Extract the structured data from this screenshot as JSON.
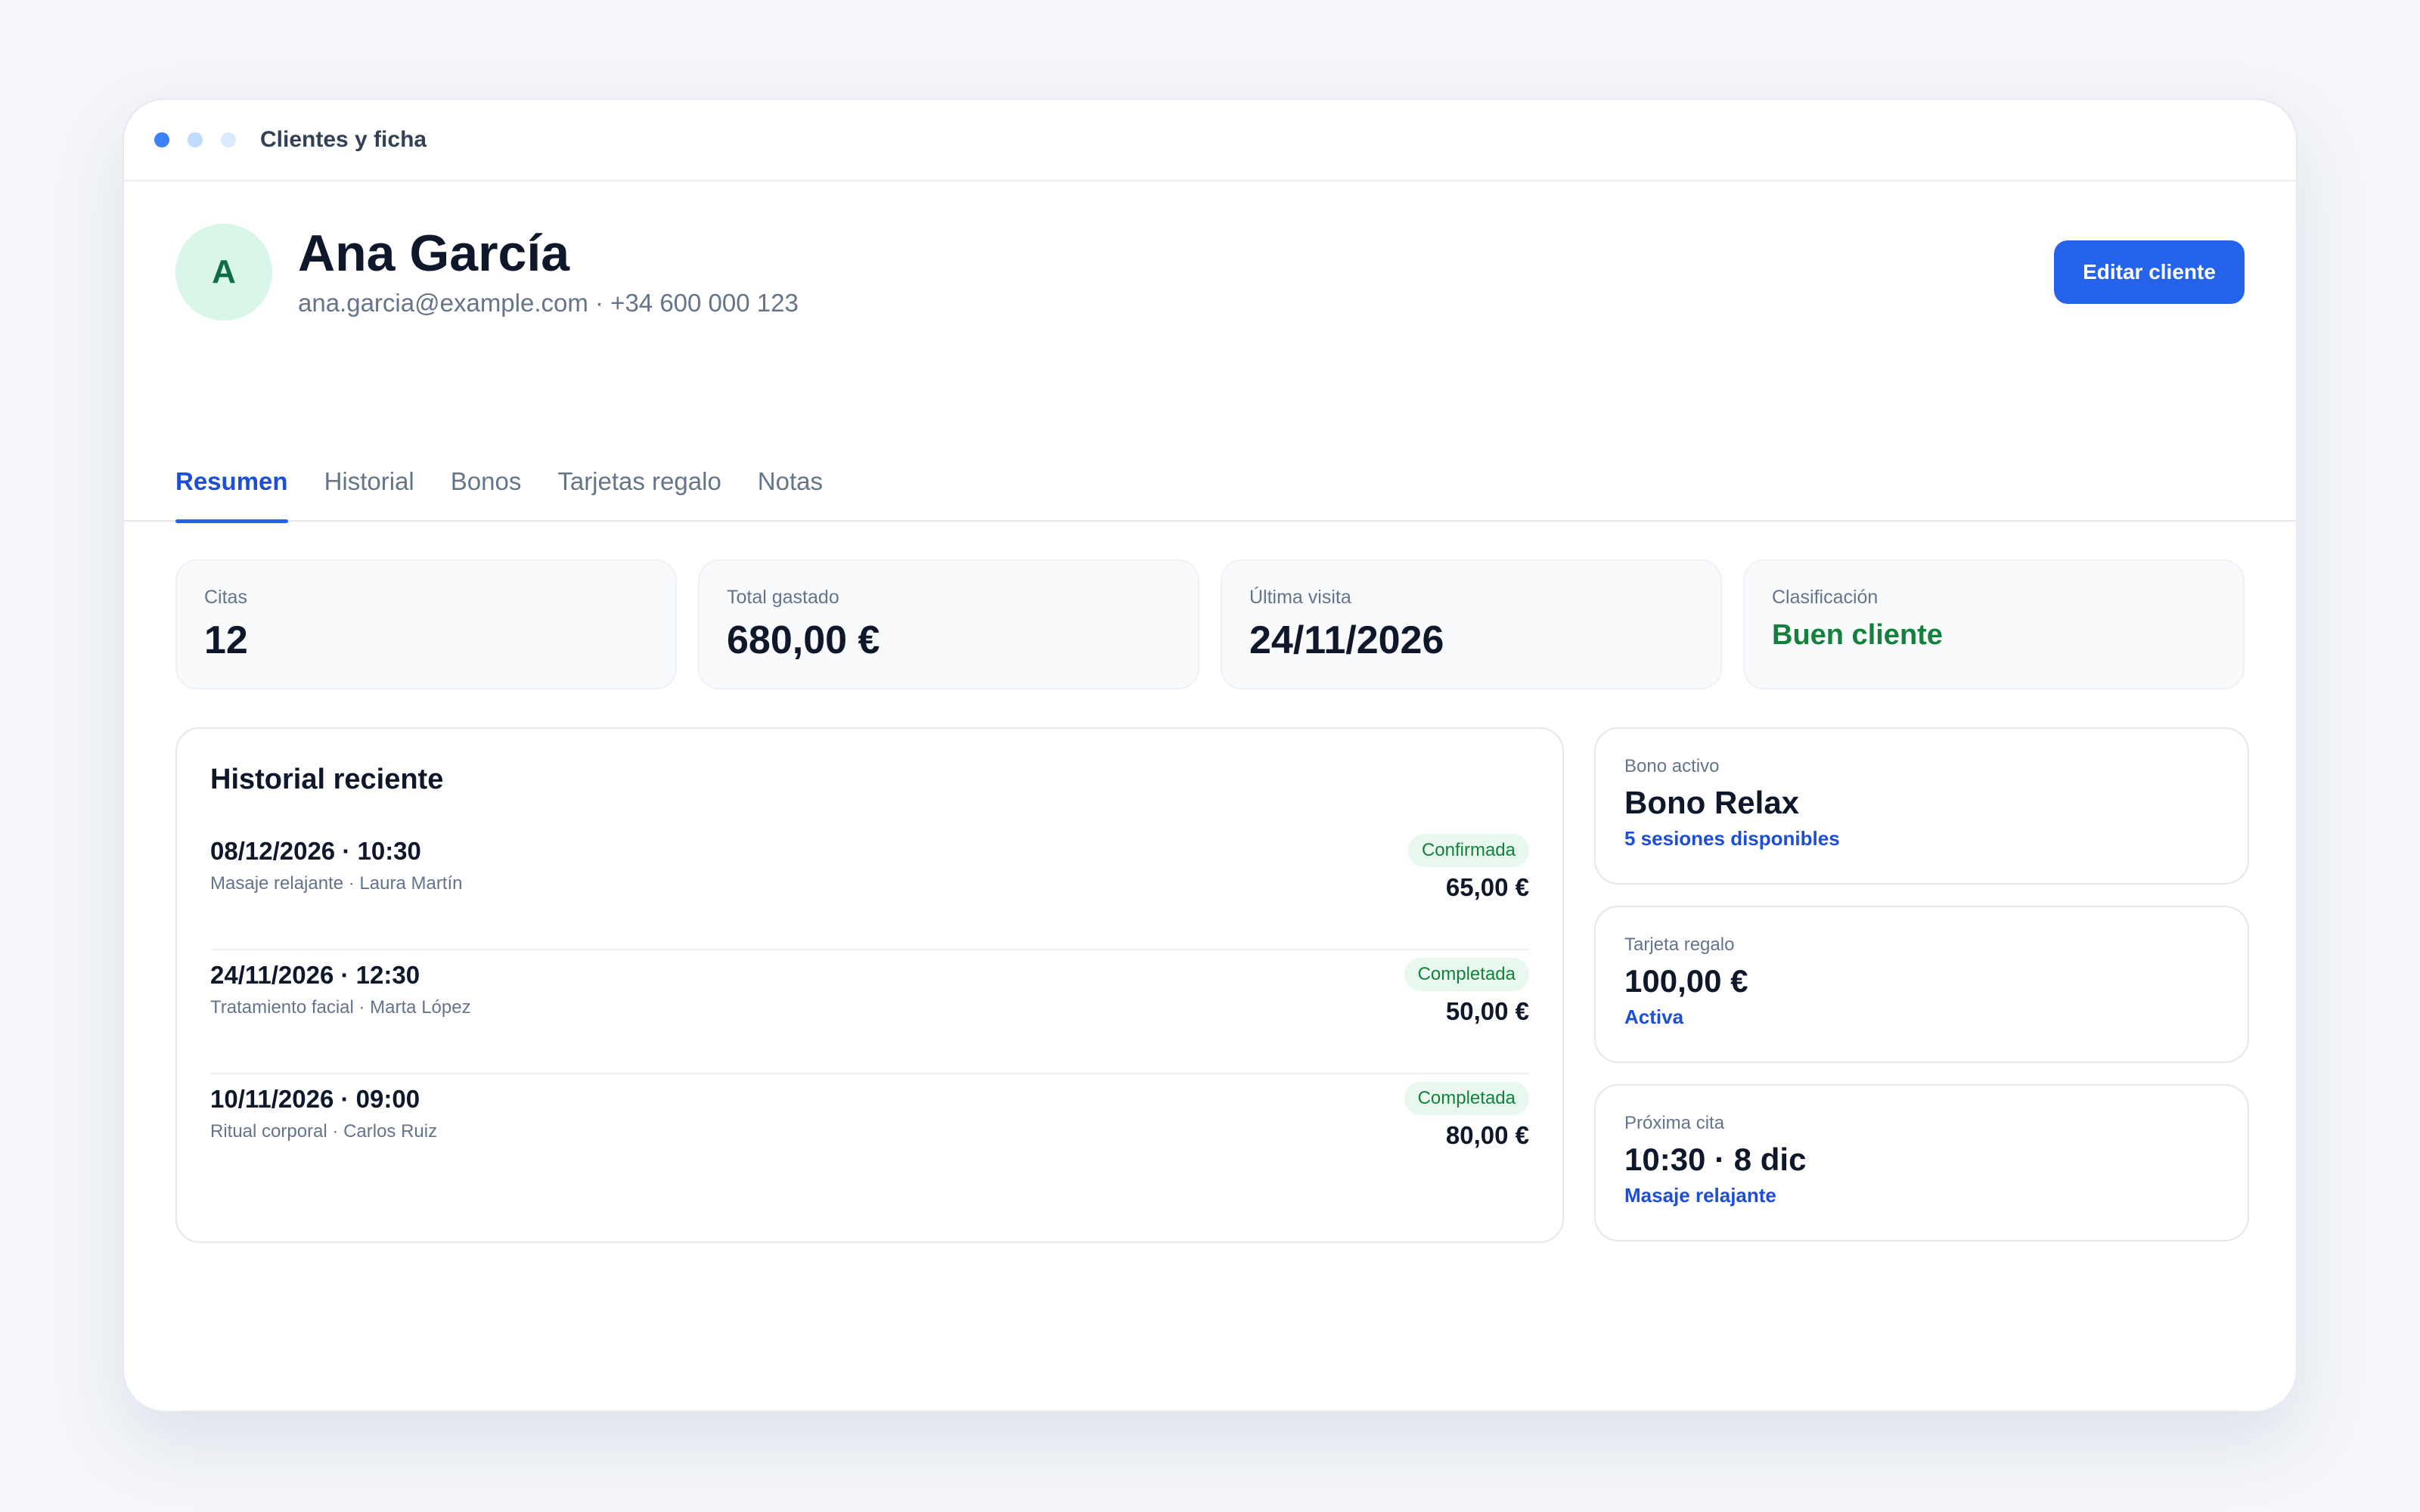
{
  "window": {
    "title": "Clientes y ficha",
    "dots": [
      "#3b82f6",
      "#bfdbfe",
      "#dbeafe"
    ]
  },
  "client": {
    "initial": "A",
    "name": "Ana García",
    "contact": "ana.garcia@example.com · +34 600 000 123",
    "edit_label": "Editar cliente"
  },
  "tabs": [
    {
      "label": "Resumen",
      "active": true
    },
    {
      "label": "Historial",
      "active": false
    },
    {
      "label": "Bonos",
      "active": false
    },
    {
      "label": "Tarjetas regalo",
      "active": false
    },
    {
      "label": "Notas",
      "active": false
    }
  ],
  "stats": [
    {
      "label": "Citas",
      "value": "12"
    },
    {
      "label": "Total gastado",
      "value": "680,00 €"
    },
    {
      "label": "Última visita",
      "value": "24/11/2026"
    },
    {
      "label": "Clasificación",
      "value": "Buen cliente"
    }
  ],
  "history": {
    "title": "Historial reciente",
    "rows": [
      {
        "when": "08/12/2026 · 10:30",
        "desc": "Masaje relajante · Laura Martín",
        "status": "Confirmada",
        "amount": "65,00 €"
      },
      {
        "when": "24/11/2026 · 12:30",
        "desc": "Tratamiento facial · Marta López",
        "status": "Completada",
        "amount": "50,00 €"
      },
      {
        "when": "10/11/2026 · 09:00",
        "desc": "Ritual corporal · Carlos Ruiz",
        "status": "Completada",
        "amount": "80,00 €"
      }
    ]
  },
  "cards": [
    {
      "label": "Bono activo",
      "value": "Bono Relax",
      "sub": "5 sesiones disponibles"
    },
    {
      "label": "Tarjeta regalo",
      "value": "100,00 €",
      "sub": "Activa"
    },
    {
      "label": "Próxima cita",
      "value": "10:30 · 8 dic",
      "sub": "Masaje relajante"
    }
  ],
  "colors": {
    "accent": "#2563eb",
    "success": "#15803d",
    "avatar_bg": "#d8f7e8"
  }
}
